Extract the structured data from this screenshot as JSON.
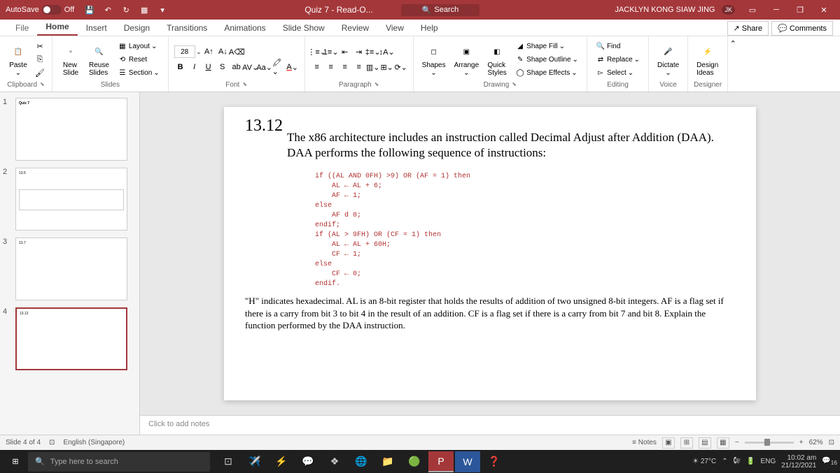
{
  "titlebar": {
    "autosave_label": "AutoSave",
    "autosave_state": "Off",
    "doc_title": "Quiz 7 - Read-O...",
    "search_label": "Search",
    "user_name": "JACKLYN KONG SIAW JING",
    "user_initials": "JK"
  },
  "tabs": {
    "file": "File",
    "home": "Home",
    "insert": "Insert",
    "design": "Design",
    "transitions": "Transitions",
    "animations": "Animations",
    "slideshow": "Slide Show",
    "review": "Review",
    "view": "View",
    "help": "Help",
    "share": "Share",
    "comments": "Comments"
  },
  "ribbon": {
    "clipboard": {
      "paste": "Paste",
      "label": "Clipboard"
    },
    "slides": {
      "new": "New\nSlide",
      "reuse": "Reuse\nSlides",
      "layout": "Layout",
      "reset": "Reset",
      "section": "Section",
      "label": "Slides"
    },
    "font": {
      "size": "28",
      "label": "Font"
    },
    "paragraph": {
      "label": "Paragraph"
    },
    "drawing": {
      "shapes": "Shapes",
      "arrange": "Arrange",
      "quick": "Quick\nStyles",
      "fill": "Shape Fill",
      "outline": "Shape Outline",
      "effects": "Shape Effects",
      "label": "Drawing"
    },
    "editing": {
      "find": "Find",
      "replace": "Replace",
      "select": "Select",
      "label": "Editing"
    },
    "voice": {
      "dictate": "Dictate",
      "label": "Voice"
    },
    "designer": {
      "ideas": "Design\nIdeas",
      "label": "Designer"
    }
  },
  "thumbs": {
    "t1": {
      "num": "1",
      "title": "Quiz 7"
    },
    "t2": {
      "num": "2",
      "title": "13.6"
    },
    "t3": {
      "num": "3",
      "title": "13.7"
    },
    "t4": {
      "num": "4",
      "title": "13.12"
    }
  },
  "slide": {
    "number": "13.12",
    "title": "The x86 architecture includes an instruction called Decimal Adjust after Addition (DAA). DAA performs the following sequence of instructions:",
    "code": "if ((AL AND 0FH) >9) OR (AF = 1) then\n    AL ← AL + 6;\n    AF ← 1;\nelse\n    AF d 0;\nendif;\nif (AL > 9FH) OR (CF = 1) then\n    AL ← AL + 60H;\n    CF ← 1;\nelse\n    CF ← 0;\nendif.",
    "body": "\"H\" indicates hexadecimal. AL is an 8-bit register that holds the results of addition of two unsigned 8-bit integers. AF is a flag set if there is a carry from bit 3 to bit 4 in the result of an addition. CF is a flag set if there is a carry from bit 7 and bit 8. Explain the function performed by the DAA instruction."
  },
  "notes": {
    "placeholder": "Click to add notes"
  },
  "statusbar": {
    "slide_pos": "Slide 4 of 4",
    "language": "English (Singapore)",
    "notes_btn": "Notes",
    "zoom": "62%"
  },
  "taskbar": {
    "search_placeholder": "Type here to search",
    "weather": "27°C",
    "lang": "ENG",
    "time": "10:02 am",
    "date": "21/12/2021",
    "notif_count": "16"
  }
}
